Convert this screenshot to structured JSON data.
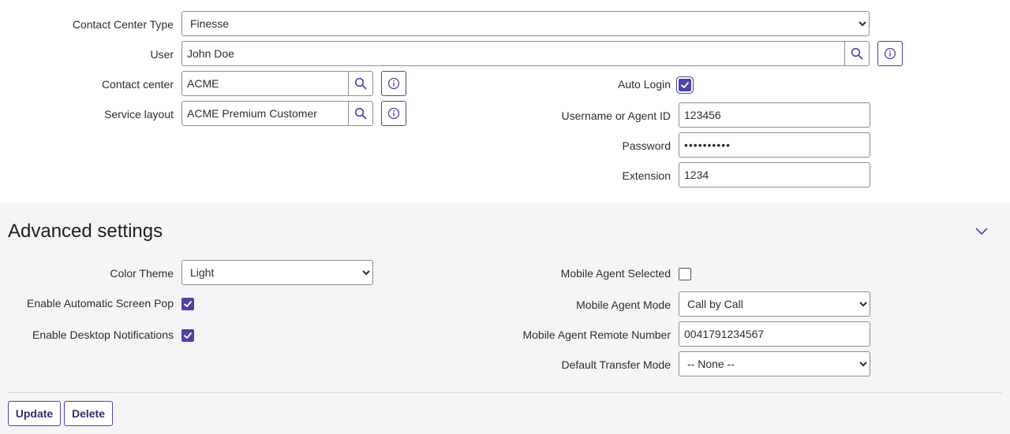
{
  "form": {
    "contact_center_type": {
      "label": "Contact Center Type",
      "value": "Finesse"
    },
    "user": {
      "label": "User",
      "value": "John Doe"
    },
    "contact_center": {
      "label": "Contact center",
      "value": "ACME"
    },
    "service_layout": {
      "label": "Service layout",
      "value": "ACME Premium Customer"
    },
    "auto_login": {
      "label": "Auto Login",
      "checked": true
    },
    "username": {
      "label": "Username or Agent ID",
      "value": "123456"
    },
    "password": {
      "label": "Password",
      "value": "••••••••••"
    },
    "extension": {
      "label": "Extension",
      "value": "1234"
    }
  },
  "advanced": {
    "title": "Advanced settings",
    "color_theme": {
      "label": "Color Theme",
      "value": "Light"
    },
    "screen_pop": {
      "label": "Enable Automatic Screen Pop",
      "checked": true
    },
    "desktop_notifications": {
      "label": "Enable Desktop Notifications",
      "checked": true
    },
    "mobile_agent_selected": {
      "label": "Mobile Agent Selected",
      "checked": false
    },
    "mobile_agent_mode": {
      "label": "Mobile Agent Mode",
      "value": "Call by Call"
    },
    "mobile_agent_remote_number": {
      "label": "Mobile Agent Remote Number",
      "value": "0041791234567"
    },
    "default_transfer_mode": {
      "label": "Default Transfer Mode",
      "value": "-- None --"
    }
  },
  "actions": {
    "update_label": "Update",
    "delete_label": "Delete"
  },
  "icons": {
    "search": "search-icon",
    "info": "info-icon",
    "check": "check-icon",
    "chevron": "chevron-down-icon"
  },
  "colors": {
    "accent": "#4b45a6",
    "section_bg": "#f5f5f8",
    "border": "#8e8e8e"
  }
}
